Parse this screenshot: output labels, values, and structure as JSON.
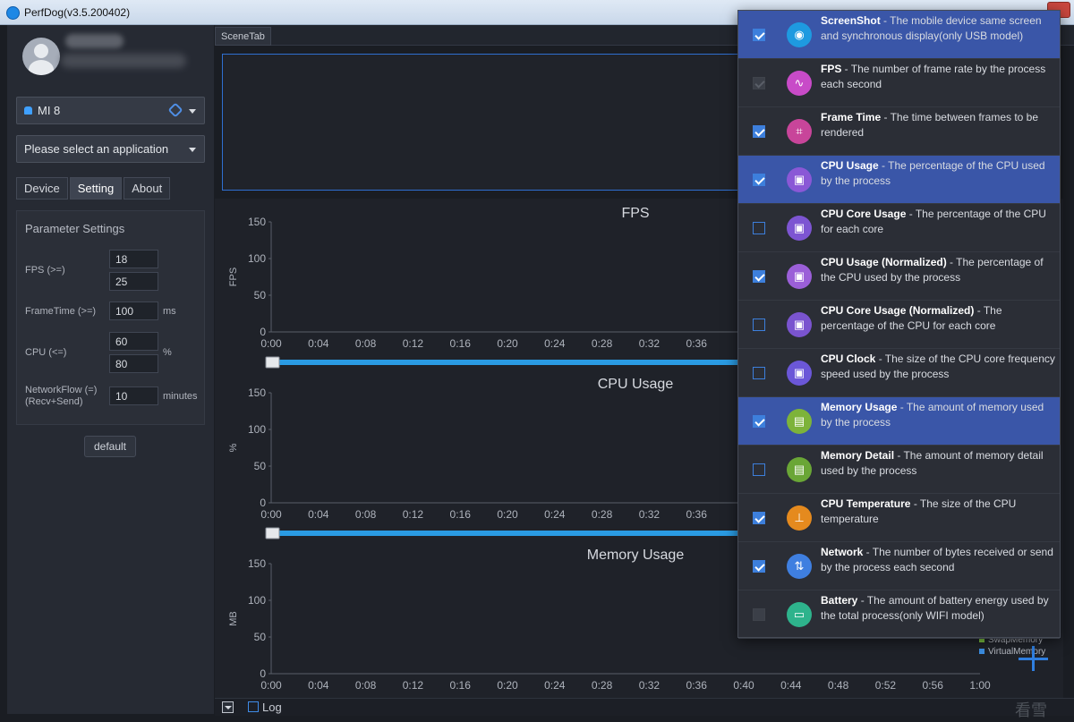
{
  "window": {
    "title": "PerfDog(v3.5.200402)"
  },
  "sidebar": {
    "device": "MI 8",
    "app_placeholder": "Please select an application",
    "tabs": [
      "Device",
      "Setting",
      "About"
    ],
    "active_tab": "Setting",
    "params": {
      "title": "Parameter Settings",
      "fps_label": "FPS (>=)",
      "fps_values": [
        "18",
        "25"
      ],
      "frametime_label": "FrameTime (>=)",
      "frametime_value": "100",
      "frametime_unit": "ms",
      "cpu_label": "CPU (<=)",
      "cpu_values": [
        "60",
        "80"
      ],
      "cpu_unit": "%",
      "network_label_line1": "NetworkFlow (=)",
      "network_label_line2": "(Recv+Send)",
      "network_value": "10",
      "network_unit": "minutes",
      "default_button": "default"
    }
  },
  "scene_tab": "SceneTab",
  "bottom": {
    "log_label": "Log",
    "watermark": "看雪"
  },
  "legend": {
    "items": [
      {
        "name": "SwapMemory",
        "color": "#7cc242"
      },
      {
        "name": "VirtualMemory",
        "color": "#3b8de0"
      }
    ]
  },
  "dropdown": {
    "items": [
      {
        "title": "ScreenShot",
        "desc": " - The mobile device same screen and synchronous display(only USB model)",
        "checked": true,
        "disabled": false,
        "highlight": true,
        "icon": "camera-icon",
        "color": "#1e9ae0"
      },
      {
        "title": "FPS",
        "desc": " - The number of frame rate by the process each second",
        "checked": true,
        "disabled": true,
        "highlight": false,
        "icon": "pulse-icon",
        "color": "#c84bc8"
      },
      {
        "title": "Frame Time",
        "desc": " - The time between frames to be rendered",
        "checked": true,
        "disabled": false,
        "highlight": false,
        "icon": "frame-icon",
        "color": "#c8459a"
      },
      {
        "title": "CPU Usage",
        "desc": " - The percentage of the CPU used by the process",
        "checked": true,
        "disabled": false,
        "highlight": true,
        "icon": "chip-icon",
        "color": "#8a58d6"
      },
      {
        "title": "CPU Core Usage",
        "desc": " - The percentage of the CPU for each core",
        "checked": false,
        "disabled": false,
        "highlight": false,
        "icon": "chip-icon",
        "color": "#7d55d2"
      },
      {
        "title": "CPU Usage (Normalized)",
        "desc": " - The percentage of the CPU used by the process",
        "checked": true,
        "disabled": false,
        "highlight": false,
        "icon": "chip-icon",
        "color": "#9b5fd8"
      },
      {
        "title": "CPU Core Usage (Normalized)",
        "desc": " - The percentage of the CPU for each core",
        "checked": false,
        "disabled": false,
        "highlight": false,
        "icon": "chip-icon",
        "color": "#7a54cf"
      },
      {
        "title": "CPU Clock",
        "desc": " - The size of the CPU core frequency speed used by the process",
        "checked": false,
        "disabled": false,
        "highlight": false,
        "icon": "chip-icon",
        "color": "#6b57d8"
      },
      {
        "title": "Memory Usage",
        "desc": " - The amount of memory used by the process",
        "checked": true,
        "disabled": false,
        "highlight": true,
        "icon": "memory-icon",
        "color": "#7db33a"
      },
      {
        "title": "Memory Detail",
        "desc": " - The amount of memory detail used by the process",
        "checked": false,
        "disabled": false,
        "highlight": false,
        "icon": "memory-icon",
        "color": "#6aa636"
      },
      {
        "title": "CPU Temperature",
        "desc": " - The size of the CPU temperature",
        "checked": true,
        "disabled": false,
        "highlight": false,
        "icon": "thermometer-icon",
        "color": "#e58a1e"
      },
      {
        "title": "Network",
        "desc": " - The number of bytes received or send by the process each second",
        "checked": true,
        "disabled": false,
        "highlight": false,
        "icon": "network-icon",
        "color": "#3f7fe0"
      },
      {
        "title": "Battery",
        "desc": " - The amount of battery energy used by the total process(only WIFI model)",
        "checked": false,
        "disabled": true,
        "highlight": false,
        "icon": "battery-icon",
        "color": "#2eb38c"
      }
    ]
  },
  "chart_data": [
    {
      "type": "line",
      "title": "FPS",
      "ylabel": "FPS",
      "ylim": [
        0,
        150
      ],
      "yticks": [
        "150",
        "100",
        "50",
        "0"
      ],
      "xticks": [
        "0:00",
        "0:04",
        "0:08",
        "0:12",
        "0:16",
        "0:20",
        "0:24",
        "0:28",
        "0:32",
        "0:36"
      ],
      "series": []
    },
    {
      "type": "line",
      "title": "CPU Usage",
      "ylabel": "%",
      "ylim": [
        0,
        150
      ],
      "yticks": [
        "150",
        "100",
        "50",
        "0"
      ],
      "xticks": [
        "0:00",
        "0:04",
        "0:08",
        "0:12",
        "0:16",
        "0:20",
        "0:24",
        "0:28",
        "0:32",
        "0:36"
      ],
      "series": []
    },
    {
      "type": "line",
      "title": "Memory Usage",
      "ylabel": "MB",
      "ylim": [
        0,
        150
      ],
      "yticks": [
        "150",
        "100",
        "50",
        "0"
      ],
      "xticks": [
        "0:00",
        "0:04",
        "0:08",
        "0:12",
        "0:16",
        "0:20",
        "0:24",
        "0:28",
        "0:32",
        "0:36",
        "0:40",
        "0:44",
        "0:48",
        "0:52",
        "0:56",
        "1:00"
      ],
      "series": []
    }
  ]
}
